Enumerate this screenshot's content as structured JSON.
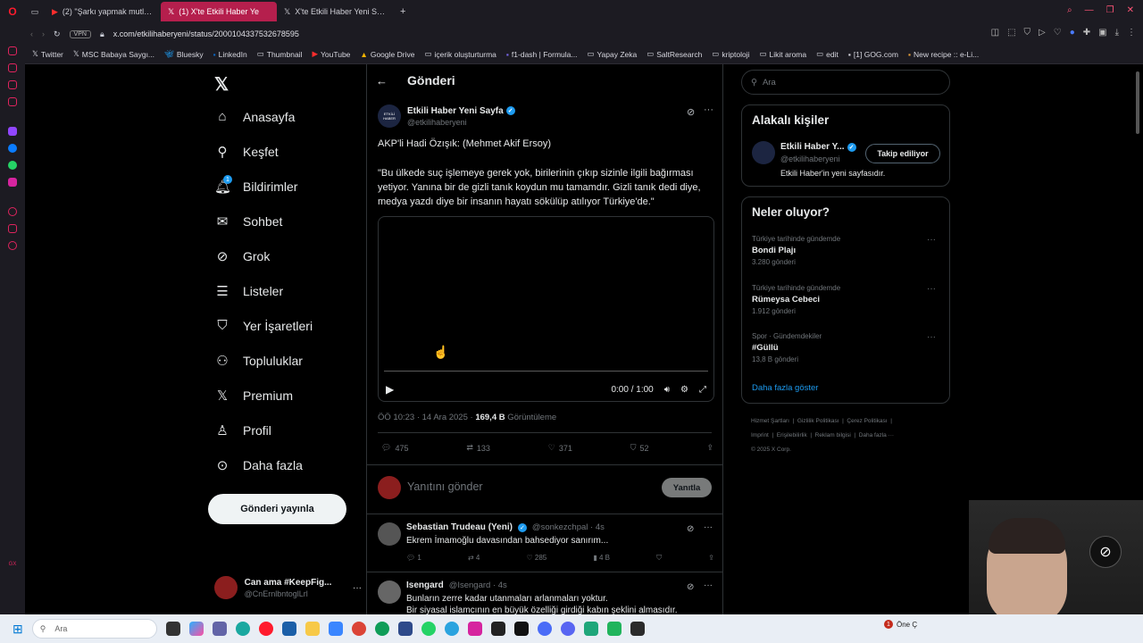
{
  "browser": {
    "tabs": [
      {
        "label": "(2) \"Şarkı yapmak mutlu a"
      },
      {
        "label": "(1) X'te Etkili Haber Ye"
      },
      {
        "label": "X'te Etkili Haber Yeni Sayfa"
      }
    ],
    "vpn": "VPN",
    "url": "x.com/etkilihaberyeni/status/2000104337532678595",
    "bookmarks": [
      "Twitter",
      "MSC Babaya Saygı...",
      "Bluesky",
      "LinkedIn",
      "Thumbnail",
      "YouTube",
      "Google Drive",
      "içerik oluşturturma",
      "f1-dash | Formula...",
      "Yapay Zeka",
      "SaltResearch",
      "kriptoloji",
      "Likit aroma",
      "edit",
      "[1] GOG.com",
      "New recipe :: e-Li..."
    ]
  },
  "nav": {
    "items": [
      "Anasayfa",
      "Keşfet",
      "Bildirimler",
      "Sohbet",
      "Grok",
      "Listeler",
      "Yer İşaretleri",
      "Topluluklar",
      "Premium",
      "Profil",
      "Daha fazla"
    ],
    "post_button": "Gönderi yayınla",
    "notif_badge": "1",
    "profile_name": "Can ama #KeepFig...",
    "profile_handle": "@CnErnlbntoglLrl"
  },
  "post": {
    "header_title": "Gönderi",
    "author_name": "Etkili Haber Yeni Sayfa",
    "author_handle": "@etkilihaberyeni",
    "avatar_text": "ETKİLİ HABER",
    "text_line1": "AKP'li Hadi Özışık: (Mehmet Akif Ersoy)",
    "text_quote": "\"Bu ülkede suç işlemeye gerek yok, birilerinin çıkıp sizinle ilgili bağırması yetiyor. Yanına bir de gizli tanık koydun mu tamamdır. Gizli tanık dedi diye, medya yazdı diye bir insanın hayatı sökülüp atılıyor Türkiye'de.\"",
    "video_time": "0:00 / 1:00",
    "meta_time": "ÖÖ 10:23 · 14 Ara 2025 · ",
    "views_count": "169,4 B",
    "views_label": " Görüntüleme",
    "replies": "475",
    "reposts": "133",
    "likes": "371",
    "bookmarks": "52",
    "reply_placeholder": "Yanıtını gönder",
    "reply_button": "Yanıtla"
  },
  "comments": [
    {
      "name": "Sebastian Trudeau (Yeni)",
      "handle": "@sonkezchpal · 4s",
      "text": "Ekrem İmamoğlu davasından bahsediyor sanırım...",
      "replies": "1",
      "reposts": "4",
      "likes": "285",
      "views": "4 B"
    },
    {
      "name": "Isengard",
      "handle": "@Isengard · 4s",
      "text": "Bunların zerre kadar utanmaları arlanmaları yoktur.",
      "text2": "Bir siyasal islamcının en büyük özelliği girdiği kabın şeklini almasıdır."
    }
  ],
  "right": {
    "search_placeholder": "Ara",
    "related_title": "Alakalı kişiler",
    "related_name": "Etkili Haber Y...",
    "related_handle": "@etkilihaberyeni",
    "related_bio": "Etkili Haber'in yeni sayfasıdır.",
    "follow_label": "Takip ediliyor",
    "trends_title": "Neler oluyor?",
    "trends": [
      {
        "category": "Türkiye tarihinde gündemde",
        "title": "Bondi Plajı",
        "count": "3.280 gönderi"
      },
      {
        "category": "Türkiye tarihinde gündemde",
        "title": "Rümeysa Cebeci",
        "count": "1.912 gönderi"
      },
      {
        "category": "Spor · Gündemdekiler",
        "title": "#Güllü",
        "count": "13,8 B gönderi"
      }
    ],
    "show_more": "Daha fazla göster",
    "footer_links": [
      "Hizmet Şartları",
      "Gizlilik Politikası",
      "Çerez Politikası",
      "Imprint",
      "Erişilebilirlik",
      "Reklam bilgisi",
      "Daha fazla ···"
    ],
    "copyright": "© 2025 X Corp."
  },
  "taskbar": {
    "search_placeholder": "Ara",
    "notif_count": "1",
    "notif_text": "Öne Ç"
  },
  "colors": {
    "accent": "#1d9bf0",
    "tab_active": "#b51f4d",
    "bg": "#000000"
  }
}
